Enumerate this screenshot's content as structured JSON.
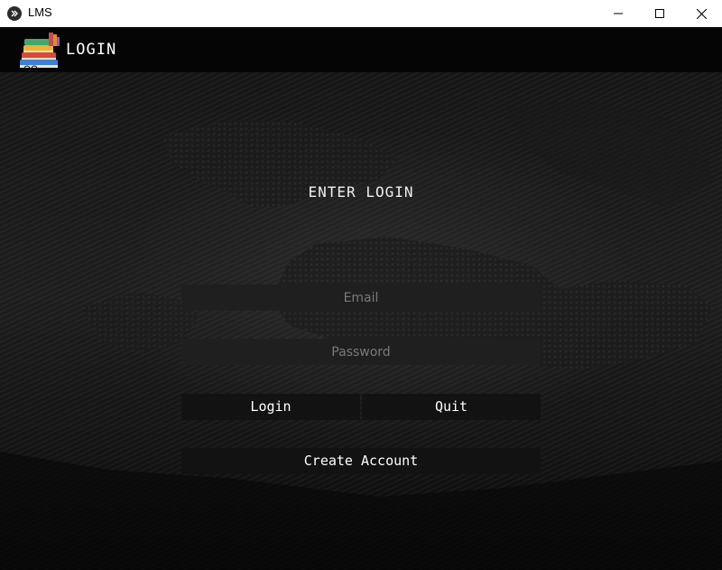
{
  "window": {
    "title": "LMS",
    "icon": "kivy-icon"
  },
  "header": {
    "title": "LOGIN",
    "logo": "books-stack-logo"
  },
  "form": {
    "heading": "ENTER LOGIN",
    "email_placeholder": "Email",
    "email_value": "",
    "password_placeholder": "Password",
    "password_value": ""
  },
  "buttons": {
    "login": "Login",
    "quit": "Quit",
    "create_account": "Create Account"
  },
  "colors": {
    "header_bg": "#050505",
    "field_bg": "#1f1f1f",
    "button_bg": "#121212",
    "text": "#ffffff"
  }
}
